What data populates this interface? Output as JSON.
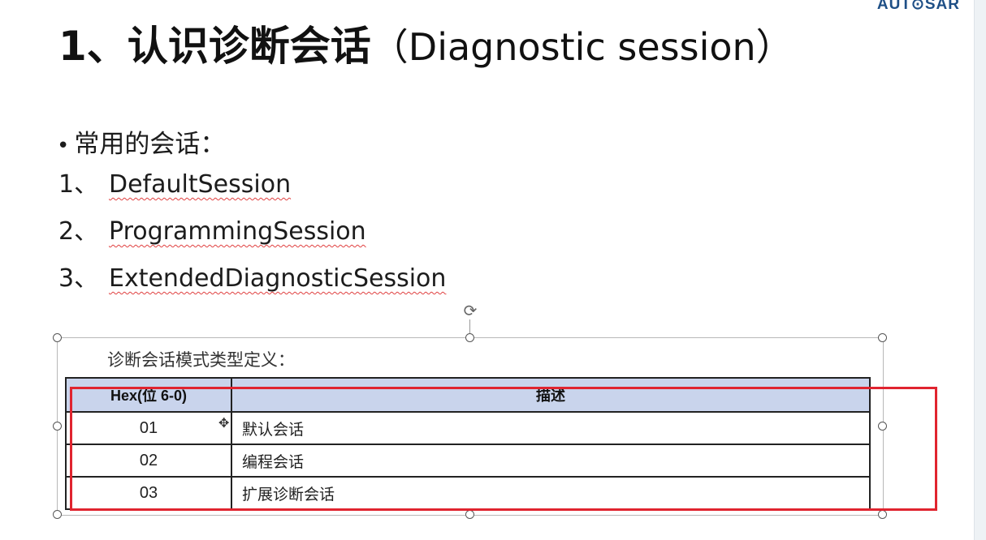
{
  "slide": {
    "logo": "AUT⊙SAR",
    "title_cn": "1、认识诊断会话",
    "title_en": "（Diagnostic session）",
    "bullet": "常用的会话：",
    "sessions": [
      {
        "num": "1、",
        "name": "DefaultSession"
      },
      {
        "num": "2、",
        "name": "ProgrammingSession"
      },
      {
        "num": "3、",
        "name": "ExtendedDiagnosticSession"
      }
    ]
  },
  "table": {
    "caption": "诊断会话模式类型定义：",
    "headers": {
      "hex": "Hex(位 6-0)",
      "desc": "描述"
    },
    "rows": [
      {
        "hex": "01",
        "desc": "默认会话"
      },
      {
        "hex": "02",
        "desc": "编程会话"
      },
      {
        "hex": "03",
        "desc": "扩展诊断会话"
      }
    ]
  },
  "colors": {
    "highlight_box": "#e0242f",
    "header_fill": "#c9d4ec",
    "logo": "#1e4f86",
    "spellcheck_underline": "#e04040"
  },
  "icons": {
    "rotate": "rotate-handle-icon",
    "cursor": "move-cursor-icon"
  }
}
